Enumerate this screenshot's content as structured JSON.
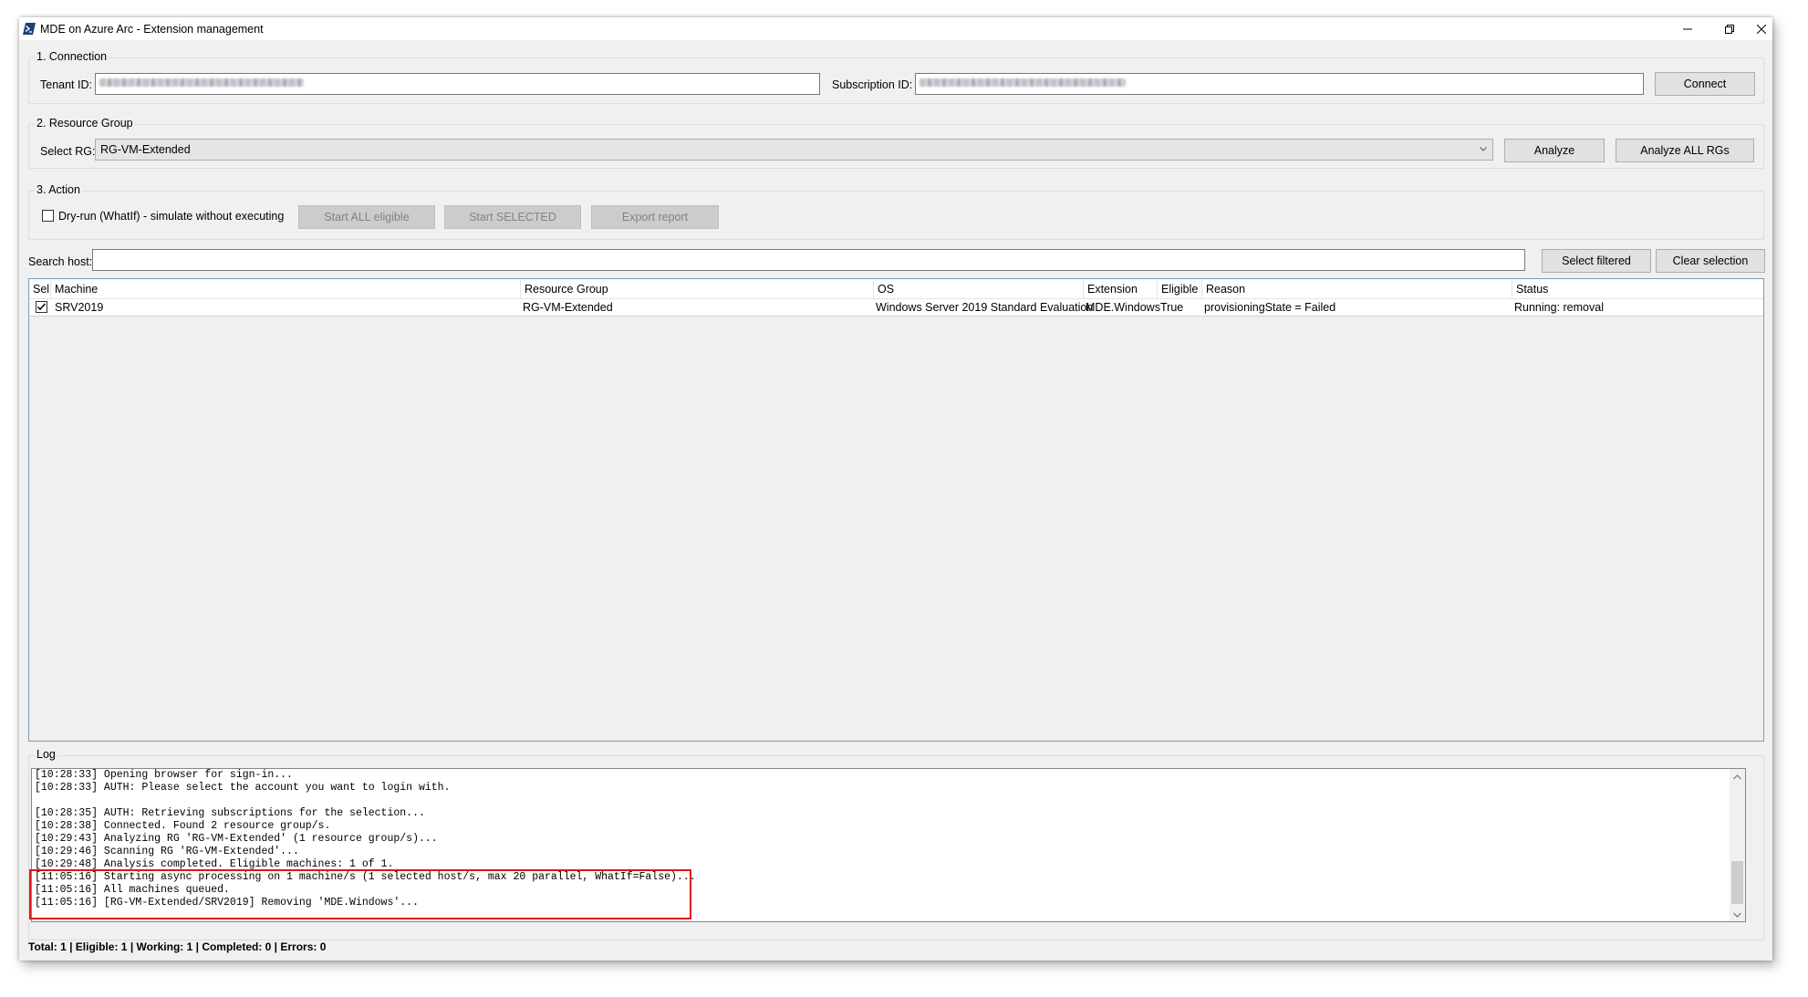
{
  "window": {
    "title": "MDE on Azure Arc - Extension management"
  },
  "connection": {
    "group_label": "1. Connection",
    "tenant_label": "Tenant ID:",
    "subscription_label": "Subscription ID:",
    "connect_label": "Connect"
  },
  "resource_group": {
    "group_label": "2. Resource Group",
    "select_label": "Select RG:",
    "selected": "RG-VM-Extended",
    "analyze_label": "Analyze",
    "analyze_all_label": "Analyze ALL RGs"
  },
  "action": {
    "group_label": "3. Action",
    "dryrun_label": "Dry-run (WhatIf) - simulate without executing",
    "dryrun_checked": false,
    "start_all_label": "Start ALL eligible",
    "start_selected_label": "Start SELECTED",
    "export_label": "Export report"
  },
  "search": {
    "label": "Search host:",
    "value": "",
    "select_filtered_label": "Select filtered",
    "clear_selection_label": "Clear selection"
  },
  "grid": {
    "columns": [
      "Sel",
      "Machine",
      "Resource Group",
      "OS",
      "Extension",
      "Eligible",
      "Reason",
      "Status"
    ],
    "rows": [
      {
        "sel": true,
        "machine": "SRV2019",
        "resource_group": "RG-VM-Extended",
        "os": "Windows Server 2019 Standard Evaluation",
        "extension": "MDE.Windows",
        "eligible": "True",
        "reason": "provisioningState = Failed",
        "status": "Running: removal"
      }
    ]
  },
  "log": {
    "group_label": "Log",
    "lines": [
      "[10:28:33] Opening browser for sign-in...",
      "[10:28:33] AUTH: Please select the account you want to login with.",
      "",
      "[10:28:35] AUTH: Retrieving subscriptions for the selection...",
      "[10:28:38] Connected. Found 2 resource group/s.",
      "[10:29:43] Analyzing RG 'RG-VM-Extended' (1 resource group/s)...",
      "[10:29:46] Scanning RG 'RG-VM-Extended'...",
      "[10:29:48] Analysis completed. Eligible machines: 1 of 1.",
      "[11:05:16] Starting async processing on 1 machine/s (1 selected host/s, max 20 parallel, WhatIf=False)...",
      "[11:05:16] All machines queued.",
      "[11:05:16] [RG-VM-Extended/SRV2019] Removing 'MDE.Windows'..."
    ]
  },
  "status_bar": {
    "text": "Total: 1  |  Eligible: 1  |  Working: 1  |  Completed: 0  |  Errors: 0"
  },
  "colors": {
    "highlight": "#e0141e",
    "grid_border": "#7a9bc0"
  }
}
